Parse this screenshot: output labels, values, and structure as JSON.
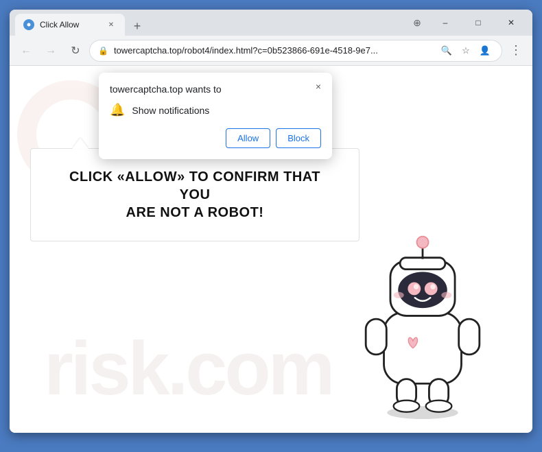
{
  "browser": {
    "title": "Click Allow",
    "tab_title": "Click Allow",
    "url": "towercaptcha.top/robot4/index.html?c=0b523866-691e-4518-9e7...",
    "window_controls": {
      "minimize": "–",
      "maximize": "□",
      "close": "✕"
    },
    "nav": {
      "back_label": "←",
      "forward_label": "→",
      "reload_label": "↻"
    }
  },
  "notification_popup": {
    "title": "towercaptcha.top wants to",
    "permission": "Show notifications",
    "allow_label": "Allow",
    "block_label": "Block",
    "close_label": "×"
  },
  "page": {
    "message_line1": "CLICK «ALLOW» TO CONFIRM THAT YOU",
    "message_line2": "ARE NOT A ROBOT!",
    "watermark": "risk.com"
  }
}
